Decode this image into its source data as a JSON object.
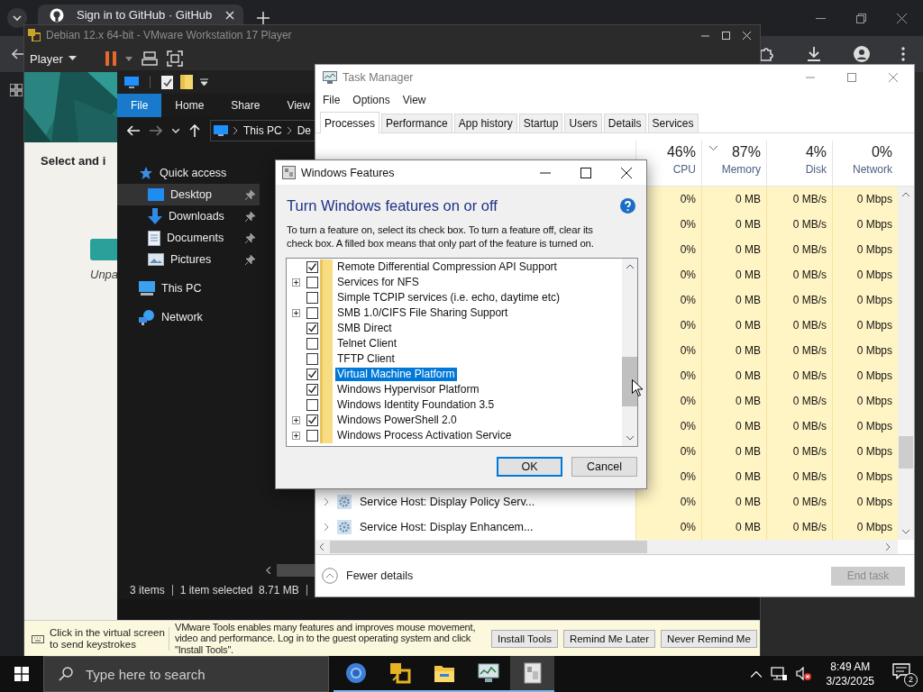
{
  "browser": {
    "tab_title": "Sign in to GitHub · GitHub"
  },
  "vmware": {
    "title": "Debian 12.x 64-bit - VMware Workstation 17 Player",
    "menu": "Player",
    "guest": {
      "heading": "Select and i",
      "caption": "Unpa"
    },
    "info_bar": {
      "hint": "Click in the virtual screen to send keystrokes",
      "message": "VMware Tools enables many features and improves mouse movement, video and performance. Log in to the guest operating system and click \"Install Tools\".",
      "buttons": [
        "Install Tools",
        "Remind Me Later",
        "Never Remind Me"
      ]
    }
  },
  "explorer": {
    "ribbon_tabs": [
      {
        "label": "File",
        "selected": true
      },
      {
        "label": "Home",
        "selected": false
      },
      {
        "label": "Share",
        "selected": false
      },
      {
        "label": "View",
        "selected": false
      }
    ],
    "breadcrumb": [
      "This PC",
      "De"
    ],
    "nav": [
      {
        "label": "Quick access",
        "kind": "star",
        "selected": false,
        "children": [
          {
            "label": "Desktop",
            "kind": "desktop",
            "pinned": true,
            "selected": true
          },
          {
            "label": "Downloads",
            "kind": "downloads",
            "pinned": true,
            "selected": false
          },
          {
            "label": "Documents",
            "kind": "documents",
            "pinned": true,
            "selected": false
          },
          {
            "label": "Pictures",
            "kind": "pictures",
            "pinned": true,
            "selected": false
          }
        ]
      },
      {
        "label": "This PC",
        "kind": "pc",
        "selected": false
      },
      {
        "label": "Network",
        "kind": "network",
        "selected": false
      }
    ],
    "status": [
      "3 items",
      "1 item selected  8.71 MB"
    ]
  },
  "task_manager": {
    "title": "Task Manager",
    "menu": [
      "File",
      "Options",
      "View"
    ],
    "tabs": [
      {
        "label": "Processes",
        "selected": true
      },
      {
        "label": "Performance",
        "selected": false
      },
      {
        "label": "App history",
        "selected": false
      },
      {
        "label": "Startup",
        "selected": false
      },
      {
        "label": "Users",
        "selected": false
      },
      {
        "label": "Details",
        "selected": false
      },
      {
        "label": "Services",
        "selected": false
      }
    ],
    "columns": [
      {
        "usage": "46%",
        "label": "CPU",
        "sorted": false
      },
      {
        "usage": "87%",
        "label": "Memory",
        "sorted": true
      },
      {
        "usage": "4%",
        "label": "Disk",
        "sorted": false
      },
      {
        "usage": "0%",
        "label": "Network",
        "sorted": false
      }
    ],
    "rows": [
      {
        "cells": [
          "0%",
          "0 MB",
          "0 MB/s",
          "0 Mbps"
        ]
      },
      {
        "cells": [
          "0%",
          "0 MB",
          "0 MB/s",
          "0 Mbps"
        ]
      },
      {
        "cells": [
          "0%",
          "0 MB",
          "0 MB/s",
          "0 Mbps"
        ]
      },
      {
        "cells": [
          "0%",
          "0 MB",
          "0 MB/s",
          "0 Mbps"
        ]
      },
      {
        "cells": [
          "0%",
          "0 MB",
          "0 MB/s",
          "0 Mbps"
        ]
      },
      {
        "cells": [
          "0%",
          "0 MB",
          "0 MB/s",
          "0 Mbps"
        ]
      },
      {
        "cells": [
          "0%",
          "0 MB",
          "0 MB/s",
          "0 Mbps"
        ]
      },
      {
        "cells": [
          "0%",
          "0 MB",
          "0 MB/s",
          "0 Mbps"
        ]
      },
      {
        "cells": [
          "0%",
          "0 MB",
          "0 MB/s",
          "0 Mbps"
        ]
      },
      {
        "cells": [
          "0%",
          "0 MB",
          "0 MB/s",
          "0 Mbps"
        ]
      },
      {
        "cells": [
          "0%",
          "0 MB",
          "0 MB/s",
          "0 Mbps"
        ]
      },
      {
        "cells": [
          "0%",
          "0 MB",
          "0 MB/s",
          "0 Mbps"
        ]
      },
      {
        "name": "Service Host: Display Policy Serv...",
        "cells": [
          "0%",
          "0 MB",
          "0 MB/s",
          "0 Mbps"
        ]
      },
      {
        "name": "Service Host: Display Enhancem...",
        "cells": [
          "0%",
          "0 MB",
          "0 MB/s",
          "0 Mbps"
        ]
      }
    ],
    "footer": {
      "toggle": "Fewer details",
      "end_task": {
        "label": "End task",
        "disabled": true
      }
    }
  },
  "dialog": {
    "title": "Windows Features",
    "heading": "Turn Windows features on or off",
    "description": "To turn a feature on, select its check box. To turn a feature off, clear its check box. A filled box means that only part of the feature is turned on.",
    "features": [
      {
        "label": "Remote Differential Compression API Support",
        "checked": true,
        "expandable": false,
        "selected": false
      },
      {
        "label": "Services for NFS",
        "checked": false,
        "expandable": true,
        "selected": false
      },
      {
        "label": "Simple TCPIP services (i.e. echo, daytime etc)",
        "checked": false,
        "expandable": false,
        "selected": false
      },
      {
        "label": "SMB 1.0/CIFS File Sharing Support",
        "checked": false,
        "expandable": true,
        "selected": false
      },
      {
        "label": "SMB Direct",
        "checked": true,
        "expandable": false,
        "selected": false
      },
      {
        "label": "Telnet Client",
        "checked": false,
        "expandable": false,
        "selected": false
      },
      {
        "label": "TFTP Client",
        "checked": false,
        "expandable": false,
        "selected": false
      },
      {
        "label": "Virtual Machine Platform",
        "checked": true,
        "expandable": false,
        "selected": true
      },
      {
        "label": "Windows Hypervisor Platform",
        "checked": true,
        "expandable": false,
        "selected": false
      },
      {
        "label": "Windows Identity Foundation 3.5",
        "checked": false,
        "expandable": false,
        "selected": false
      },
      {
        "label": "Windows PowerShell 2.0",
        "checked": true,
        "expandable": true,
        "selected": false
      },
      {
        "label": "Windows Process Activation Service",
        "checked": false,
        "expandable": true,
        "selected": false
      }
    ],
    "buttons": [
      {
        "label": "OK",
        "default": true
      },
      {
        "label": "Cancel",
        "default": false
      }
    ]
  },
  "taskbar": {
    "search_placeholder": "Type here to search",
    "apps": [
      {
        "kind": "browser",
        "running": true,
        "selected": false
      },
      {
        "kind": "vmware",
        "running": true,
        "selected": false
      },
      {
        "kind": "files",
        "running": true,
        "selected": false
      },
      {
        "kind": "monitor",
        "running": true,
        "selected": false
      },
      {
        "kind": "features",
        "running": true,
        "selected": true
      }
    ],
    "time": "8:49 AM",
    "date": "3/23/2025",
    "notifications": "2"
  }
}
